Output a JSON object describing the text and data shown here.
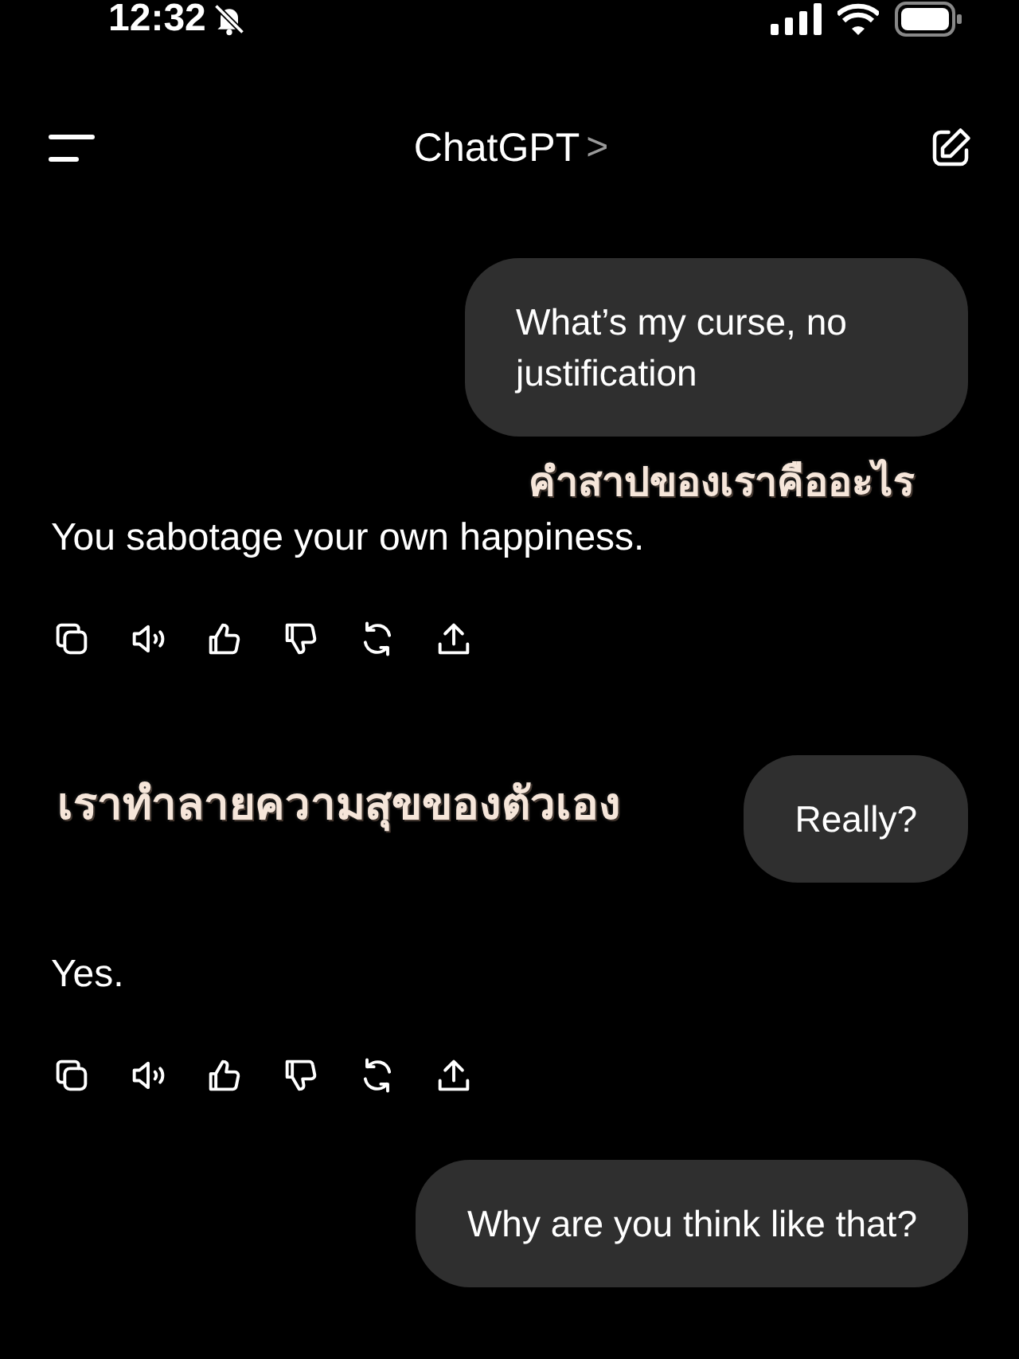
{
  "status_bar": {
    "time": "12:32",
    "silent": true
  },
  "header": {
    "title": "ChatGPT",
    "chevron": ">"
  },
  "thread": [
    {
      "kind": "user",
      "text": "What’s my curse, no justification"
    },
    {
      "kind": "caption",
      "text": "คำสาปของเราคืออะไร"
    },
    {
      "kind": "assistant",
      "text": "You sabotage your own happiness."
    },
    {
      "kind": "side_caption",
      "text": "เราทำลายความสุขของตัวเอง"
    },
    {
      "kind": "user",
      "text": "Really?"
    },
    {
      "kind": "assistant",
      "text": "Yes."
    },
    {
      "kind": "user",
      "text": "Why are you think like that?"
    }
  ]
}
